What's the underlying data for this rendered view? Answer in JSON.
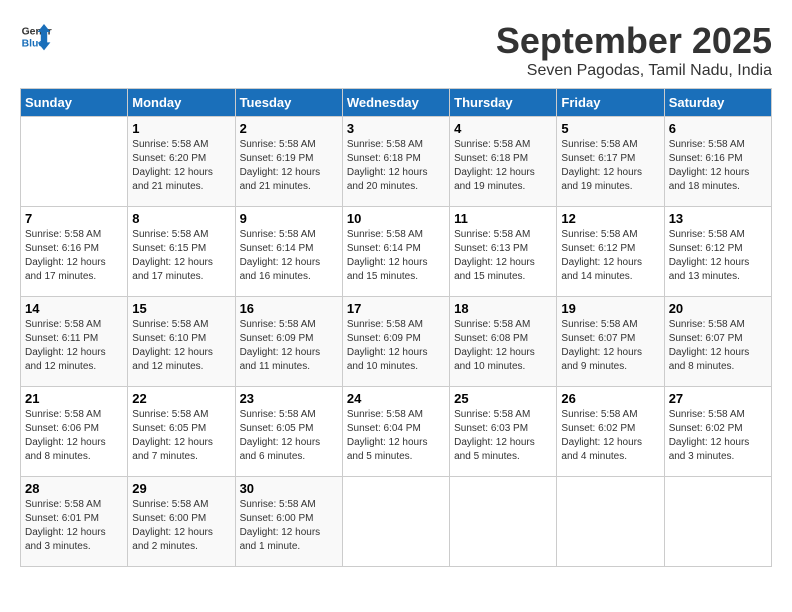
{
  "logo": {
    "line1": "General",
    "line2": "Blue"
  },
  "title": "September 2025",
  "subtitle": "Seven Pagodas, Tamil Nadu, India",
  "days_header": [
    "Sunday",
    "Monday",
    "Tuesday",
    "Wednesday",
    "Thursday",
    "Friday",
    "Saturday"
  ],
  "weeks": [
    [
      {
        "day": "",
        "info": ""
      },
      {
        "day": "1",
        "info": "Sunrise: 5:58 AM\nSunset: 6:20 PM\nDaylight: 12 hours\nand 21 minutes."
      },
      {
        "day": "2",
        "info": "Sunrise: 5:58 AM\nSunset: 6:19 PM\nDaylight: 12 hours\nand 21 minutes."
      },
      {
        "day": "3",
        "info": "Sunrise: 5:58 AM\nSunset: 6:18 PM\nDaylight: 12 hours\nand 20 minutes."
      },
      {
        "day": "4",
        "info": "Sunrise: 5:58 AM\nSunset: 6:18 PM\nDaylight: 12 hours\nand 19 minutes."
      },
      {
        "day": "5",
        "info": "Sunrise: 5:58 AM\nSunset: 6:17 PM\nDaylight: 12 hours\nand 19 minutes."
      },
      {
        "day": "6",
        "info": "Sunrise: 5:58 AM\nSunset: 6:16 PM\nDaylight: 12 hours\nand 18 minutes."
      }
    ],
    [
      {
        "day": "7",
        "info": "Sunrise: 5:58 AM\nSunset: 6:16 PM\nDaylight: 12 hours\nand 17 minutes."
      },
      {
        "day": "8",
        "info": "Sunrise: 5:58 AM\nSunset: 6:15 PM\nDaylight: 12 hours\nand 17 minutes."
      },
      {
        "day": "9",
        "info": "Sunrise: 5:58 AM\nSunset: 6:14 PM\nDaylight: 12 hours\nand 16 minutes."
      },
      {
        "day": "10",
        "info": "Sunrise: 5:58 AM\nSunset: 6:14 PM\nDaylight: 12 hours\nand 15 minutes."
      },
      {
        "day": "11",
        "info": "Sunrise: 5:58 AM\nSunset: 6:13 PM\nDaylight: 12 hours\nand 15 minutes."
      },
      {
        "day": "12",
        "info": "Sunrise: 5:58 AM\nSunset: 6:12 PM\nDaylight: 12 hours\nand 14 minutes."
      },
      {
        "day": "13",
        "info": "Sunrise: 5:58 AM\nSunset: 6:12 PM\nDaylight: 12 hours\nand 13 minutes."
      }
    ],
    [
      {
        "day": "14",
        "info": "Sunrise: 5:58 AM\nSunset: 6:11 PM\nDaylight: 12 hours\nand 12 minutes."
      },
      {
        "day": "15",
        "info": "Sunrise: 5:58 AM\nSunset: 6:10 PM\nDaylight: 12 hours\nand 12 minutes."
      },
      {
        "day": "16",
        "info": "Sunrise: 5:58 AM\nSunset: 6:09 PM\nDaylight: 12 hours\nand 11 minutes."
      },
      {
        "day": "17",
        "info": "Sunrise: 5:58 AM\nSunset: 6:09 PM\nDaylight: 12 hours\nand 10 minutes."
      },
      {
        "day": "18",
        "info": "Sunrise: 5:58 AM\nSunset: 6:08 PM\nDaylight: 12 hours\nand 10 minutes."
      },
      {
        "day": "19",
        "info": "Sunrise: 5:58 AM\nSunset: 6:07 PM\nDaylight: 12 hours\nand 9 minutes."
      },
      {
        "day": "20",
        "info": "Sunrise: 5:58 AM\nSunset: 6:07 PM\nDaylight: 12 hours\nand 8 minutes."
      }
    ],
    [
      {
        "day": "21",
        "info": "Sunrise: 5:58 AM\nSunset: 6:06 PM\nDaylight: 12 hours\nand 8 minutes."
      },
      {
        "day": "22",
        "info": "Sunrise: 5:58 AM\nSunset: 6:05 PM\nDaylight: 12 hours\nand 7 minutes."
      },
      {
        "day": "23",
        "info": "Sunrise: 5:58 AM\nSunset: 6:05 PM\nDaylight: 12 hours\nand 6 minutes."
      },
      {
        "day": "24",
        "info": "Sunrise: 5:58 AM\nSunset: 6:04 PM\nDaylight: 12 hours\nand 5 minutes."
      },
      {
        "day": "25",
        "info": "Sunrise: 5:58 AM\nSunset: 6:03 PM\nDaylight: 12 hours\nand 5 minutes."
      },
      {
        "day": "26",
        "info": "Sunrise: 5:58 AM\nSunset: 6:02 PM\nDaylight: 12 hours\nand 4 minutes."
      },
      {
        "day": "27",
        "info": "Sunrise: 5:58 AM\nSunset: 6:02 PM\nDaylight: 12 hours\nand 3 minutes."
      }
    ],
    [
      {
        "day": "28",
        "info": "Sunrise: 5:58 AM\nSunset: 6:01 PM\nDaylight: 12 hours\nand 3 minutes."
      },
      {
        "day": "29",
        "info": "Sunrise: 5:58 AM\nSunset: 6:00 PM\nDaylight: 12 hours\nand 2 minutes."
      },
      {
        "day": "30",
        "info": "Sunrise: 5:58 AM\nSunset: 6:00 PM\nDaylight: 12 hours\nand 1 minute."
      },
      {
        "day": "",
        "info": ""
      },
      {
        "day": "",
        "info": ""
      },
      {
        "day": "",
        "info": ""
      },
      {
        "day": "",
        "info": ""
      }
    ]
  ]
}
